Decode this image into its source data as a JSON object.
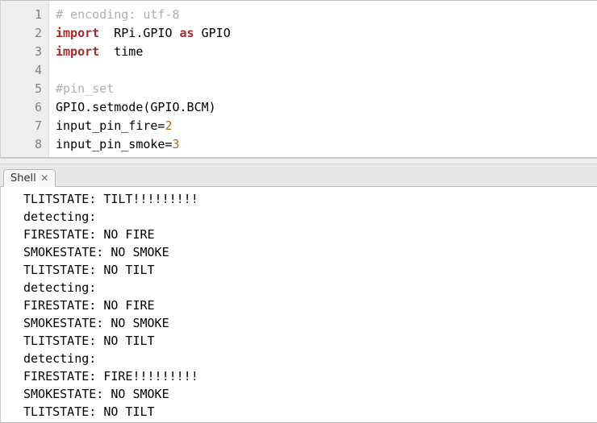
{
  "editor": {
    "gutter": [
      "1",
      "2",
      "3",
      "4",
      "5",
      "6",
      "7",
      "8"
    ],
    "lines": [
      [
        {
          "c": "tok-comment",
          "t": "# encoding: utf-8"
        }
      ],
      [
        {
          "c": "tok-keyword",
          "t": "import"
        },
        {
          "t": "  RPi.GPIO "
        },
        {
          "c": "tok-keyword",
          "t": "as"
        },
        {
          "t": " GPIO"
        }
      ],
      [
        {
          "c": "tok-keyword",
          "t": "import"
        },
        {
          "t": "  time"
        }
      ],
      [
        {
          "t": ""
        }
      ],
      [
        {
          "c": "tok-comment",
          "t": "#pin_set"
        }
      ],
      [
        {
          "t": "GPIO.setmode(GPIO.BCM)"
        }
      ],
      [
        {
          "t": "input_pin_fire="
        },
        {
          "c": "tok-number",
          "t": "2"
        }
      ],
      [
        {
          "t": "input_pin_smoke="
        },
        {
          "c": "tok-number",
          "t": "3"
        }
      ]
    ]
  },
  "tab": {
    "label": "Shell",
    "close_glyph": "✕"
  },
  "shell": {
    "lines": [
      "TLITSTATE: TILT!!!!!!!!!",
      "detecting:",
      "FIRESTATE: NO FIRE",
      "SMOKESTATE: NO SMOKE",
      "TLITSTATE: NO TILT",
      "detecting:",
      "FIRESTATE: NO FIRE",
      "SMOKESTATE: NO SMOKE",
      "TLITSTATE: NO TILT",
      "detecting:",
      "FIRESTATE: FIRE!!!!!!!!!",
      "SMOKESTATE: NO SMOKE",
      "TLITSTATE: NO TILT"
    ]
  }
}
